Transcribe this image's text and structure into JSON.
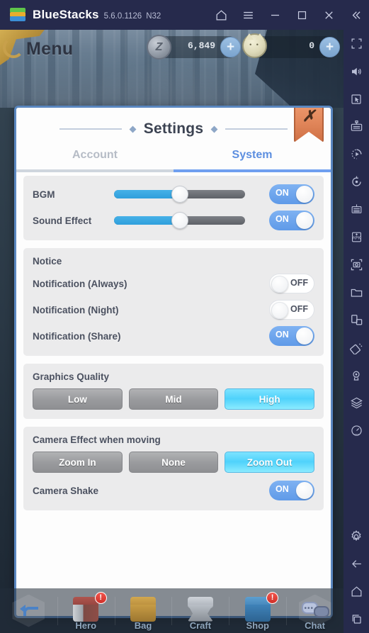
{
  "bluestacks": {
    "app_name": "BlueStacks",
    "version": "5.6.0.1126",
    "instance": "N32",
    "titlebar_buttons": [
      {
        "name": "home-icon",
        "label": "Home"
      },
      {
        "name": "hamburger-menu-icon",
        "label": "Menu"
      },
      {
        "name": "minimize-icon",
        "label": "Minimize"
      },
      {
        "name": "maximize-icon",
        "label": "Maximize"
      },
      {
        "name": "close-icon",
        "label": "Close"
      },
      {
        "name": "collapse-sidebar-icon",
        "label": "Collapse"
      }
    ]
  },
  "game_header": {
    "menu_title": "Menu",
    "currencies": [
      {
        "icon": "coin-icon",
        "value": "6,849",
        "add_label": "+"
      },
      {
        "icon": "cat-token-icon",
        "value": "0",
        "add_label": "+"
      }
    ]
  },
  "settings_panel": {
    "title": "Settings",
    "close_label": "✗",
    "tabs": [
      {
        "label": "Account",
        "active": false
      },
      {
        "label": "System",
        "active": true
      }
    ],
    "audio": {
      "bgm_label": "BGM",
      "bgm_value": 50,
      "bgm_toggle": "ON",
      "sound_effect_label": "Sound Effect",
      "sound_effect_value": 50,
      "sound_effect_toggle": "ON"
    },
    "notice": {
      "title": "Notice",
      "items": [
        {
          "label": "Notification (Always)",
          "state": "OFF"
        },
        {
          "label": "Notification (Night)",
          "state": "OFF"
        },
        {
          "label": "Notification (Share)",
          "state": "ON"
        }
      ]
    },
    "graphics": {
      "title": "Graphics Quality",
      "options": [
        {
          "label": "Low",
          "selected": false
        },
        {
          "label": "Mid",
          "selected": false
        },
        {
          "label": "High",
          "selected": true
        }
      ]
    },
    "camera": {
      "title": "Camera Effect when moving",
      "options": [
        {
          "label": "Zoom In",
          "selected": false
        },
        {
          "label": "None",
          "selected": false
        },
        {
          "label": "Zoom Out",
          "selected": true
        }
      ],
      "shake_label": "Camera Shake",
      "shake_state": "ON"
    }
  },
  "bottom_nav": {
    "back_label": "",
    "items": [
      {
        "label": "Hero",
        "badge": "!"
      },
      {
        "label": "Bag",
        "badge": ""
      },
      {
        "label": "Craft",
        "badge": ""
      },
      {
        "label": "Shop",
        "badge": "!"
      },
      {
        "label": "Chat",
        "badge": ""
      }
    ]
  },
  "sidebar": {
    "items": [
      {
        "name": "fullscreen-icon"
      },
      {
        "name": "volume-icon"
      },
      {
        "name": "cursor-pointer-icon"
      },
      {
        "name": "game-controls-icon"
      },
      {
        "name": "macro-record-icon"
      },
      {
        "name": "sync-rotate-icon"
      },
      {
        "name": "real-time-translation-icon"
      },
      {
        "name": "install-apk-icon"
      },
      {
        "name": "screenshot-icon"
      },
      {
        "name": "media-folder-icon"
      },
      {
        "name": "multi-instance-icon"
      },
      {
        "name": "eco-mode-icon"
      },
      {
        "name": "location-icon"
      },
      {
        "name": "layers-icon"
      },
      {
        "name": "performance-meter-icon"
      },
      {
        "name": "settings-gear-icon"
      },
      {
        "name": "android-back-icon"
      },
      {
        "name": "android-home-icon"
      },
      {
        "name": "android-recents-icon"
      }
    ]
  },
  "colors": {
    "titlebar_bg": "#262a4c",
    "accent_blue": "#6f9ff0",
    "tab_active": "#5d8fe0",
    "tab_inactive": "#b6bcc6",
    "slider_fill": "#2f9fdc",
    "toggle_on": "#5f9ae8",
    "selected_button": "#4fd2fb",
    "close_bookmark": "#e08559",
    "badge_red": "#cf2f28"
  }
}
